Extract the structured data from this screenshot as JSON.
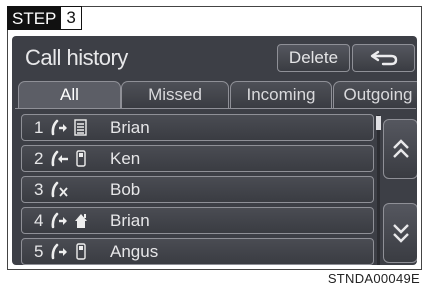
{
  "step": {
    "label": "STEP",
    "number": "3"
  },
  "screen": {
    "title": "Call history",
    "delete_label": "Delete",
    "back_icon": "return-arrow-icon"
  },
  "tabs": [
    {
      "label": "All",
      "active": true
    },
    {
      "label": "Missed",
      "active": false
    },
    {
      "label": "Incoming",
      "active": false
    },
    {
      "label": "Outgoing",
      "active": false
    }
  ],
  "calls": [
    {
      "index": "1",
      "call_icon": "outgoing-call-icon",
      "type_icon": "office-phone-icon",
      "name": "Brian"
    },
    {
      "index": "2",
      "call_icon": "incoming-call-icon",
      "type_icon": "mobile-phone-icon",
      "name": "Ken"
    },
    {
      "index": "3",
      "call_icon": "missed-call-icon",
      "type_icon": "",
      "name": "Bob"
    },
    {
      "index": "4",
      "call_icon": "outgoing-call-icon",
      "type_icon": "home-phone-icon",
      "name": "Brian"
    },
    {
      "index": "5",
      "call_icon": "outgoing-call-icon",
      "type_icon": "mobile-phone-icon",
      "name": "Angus"
    }
  ],
  "scroll": {
    "up_icon": "double-chevron-up-icon",
    "down_icon": "double-chevron-down-icon"
  },
  "figure_code": "STNDA00049E",
  "colors": {
    "screen_bg": "#3d3f46",
    "border": "#8f9097",
    "text": "#e6e6e8"
  }
}
